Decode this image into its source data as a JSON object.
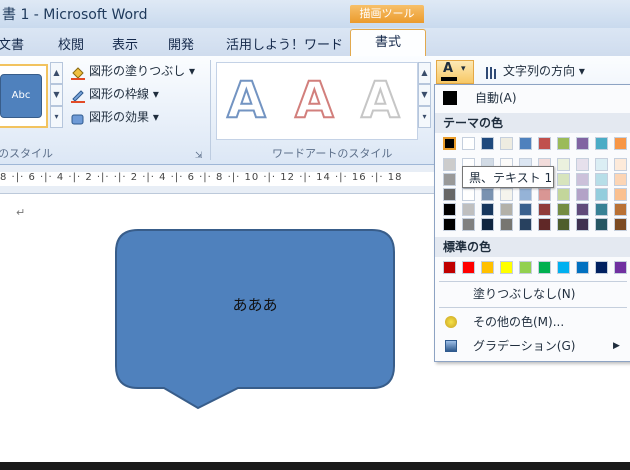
{
  "window": {
    "title": "書 1 - Microsoft Word"
  },
  "tabs": {
    "items": [
      {
        "label": "文書",
        "active": false
      },
      {
        "label": "校閲",
        "active": false
      },
      {
        "label": "表示",
        "active": false
      },
      {
        "label": "開発",
        "active": false
      },
      {
        "label": "活用しよう！ワード",
        "active": false
      },
      {
        "label": "書式",
        "active": true
      }
    ],
    "context_label": "描画ツール"
  },
  "ribbon": {
    "shape_styles": {
      "thumb_label": "Abc",
      "fill": "図形の塗りつぶし",
      "outline": "図形の枠線",
      "effects": "図形の効果",
      "group_label": "のスタイル"
    },
    "wordart": {
      "group_label": "ワードアートのスタイル",
      "letter": "A"
    },
    "text_direction": "文字列の方向"
  },
  "ruler": {
    "text": "8 ·|· 6 ·|· 4 ·|· 2 ·|·     ·|· 2 ·|· 4 ·|· 6 ·|· 8 ·|· 10 ·|· 12 ·|· 14 ·|· 16 ·|· 18"
  },
  "document": {
    "callout_text": "あああ",
    "para_mark": "↵"
  },
  "font_color_menu": {
    "automatic": "自動(A)",
    "theme_heading": "テーマの色",
    "standard_heading": "標準の色",
    "no_fill": "塗りつぶしなし(N)",
    "more_colors": "その他の色(M)...",
    "gradient": "グラデーション(G)",
    "tooltip": "黒、テキスト 1",
    "theme_colors": [
      "#000000",
      "#ffffff",
      "#1f497d",
      "#eeece1",
      "#4f81bd",
      "#c0504d",
      "#9bbb59",
      "#8064a2",
      "#4bacc6",
      "#f79646"
    ],
    "standard_colors": [
      "#c00000",
      "#ff0000",
      "#ffc000",
      "#ffff00",
      "#92d050",
      "#00b050",
      "#00b0f0",
      "#0070c0",
      "#002060",
      "#7030a0"
    ]
  },
  "colors": {
    "callout_fill": "#4f81bd",
    "callout_stroke": "#385d8a",
    "context_tab": "#eb9a2c"
  }
}
